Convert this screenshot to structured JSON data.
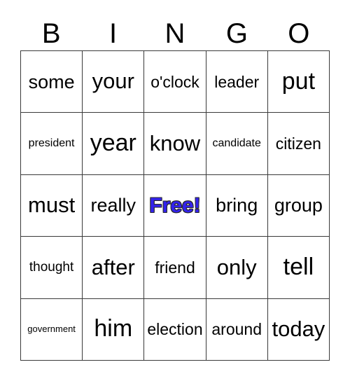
{
  "card": {
    "headers": [
      "B",
      "I",
      "N",
      "G",
      "O"
    ],
    "free_space": {
      "label": "Free!",
      "color": "#3322ee",
      "outline_color": "#2b2b2b",
      "row": 2,
      "column": 2
    },
    "colors": {
      "background": "#ffffff",
      "grid_line": "#3a3a3a",
      "text": "#000000",
      "free_text": "#3322ee"
    },
    "rows": [
      [
        {
          "word": "some",
          "size": "lg"
        },
        {
          "word": "your",
          "size": "xl"
        },
        {
          "word": "o'clock",
          "size": "md"
        },
        {
          "word": "leader",
          "size": "md"
        },
        {
          "word": "put",
          "size": "xxl"
        }
      ],
      [
        {
          "word": "president",
          "size": "xs"
        },
        {
          "word": "year",
          "size": "xxl"
        },
        {
          "word": "know",
          "size": "xl"
        },
        {
          "word": "candidate",
          "size": "xs"
        },
        {
          "word": "citizen",
          "size": "md"
        }
      ],
      [
        {
          "word": "must",
          "size": "xl"
        },
        {
          "word": "really",
          "size": "lg"
        },
        {
          "word": "Free!",
          "size": "free"
        },
        {
          "word": "bring",
          "size": "lg"
        },
        {
          "word": "group",
          "size": "lg"
        }
      ],
      [
        {
          "word": "thought",
          "size": "sm"
        },
        {
          "word": "after",
          "size": "xl"
        },
        {
          "word": "friend",
          "size": "md"
        },
        {
          "word": "only",
          "size": "xl"
        },
        {
          "word": "tell",
          "size": "xxl"
        }
      ],
      [
        {
          "word": "government",
          "size": "xxs"
        },
        {
          "word": "him",
          "size": "xxl"
        },
        {
          "word": "election",
          "size": "md"
        },
        {
          "word": "around",
          "size": "md"
        },
        {
          "word": "today",
          "size": "xl"
        }
      ]
    ]
  }
}
